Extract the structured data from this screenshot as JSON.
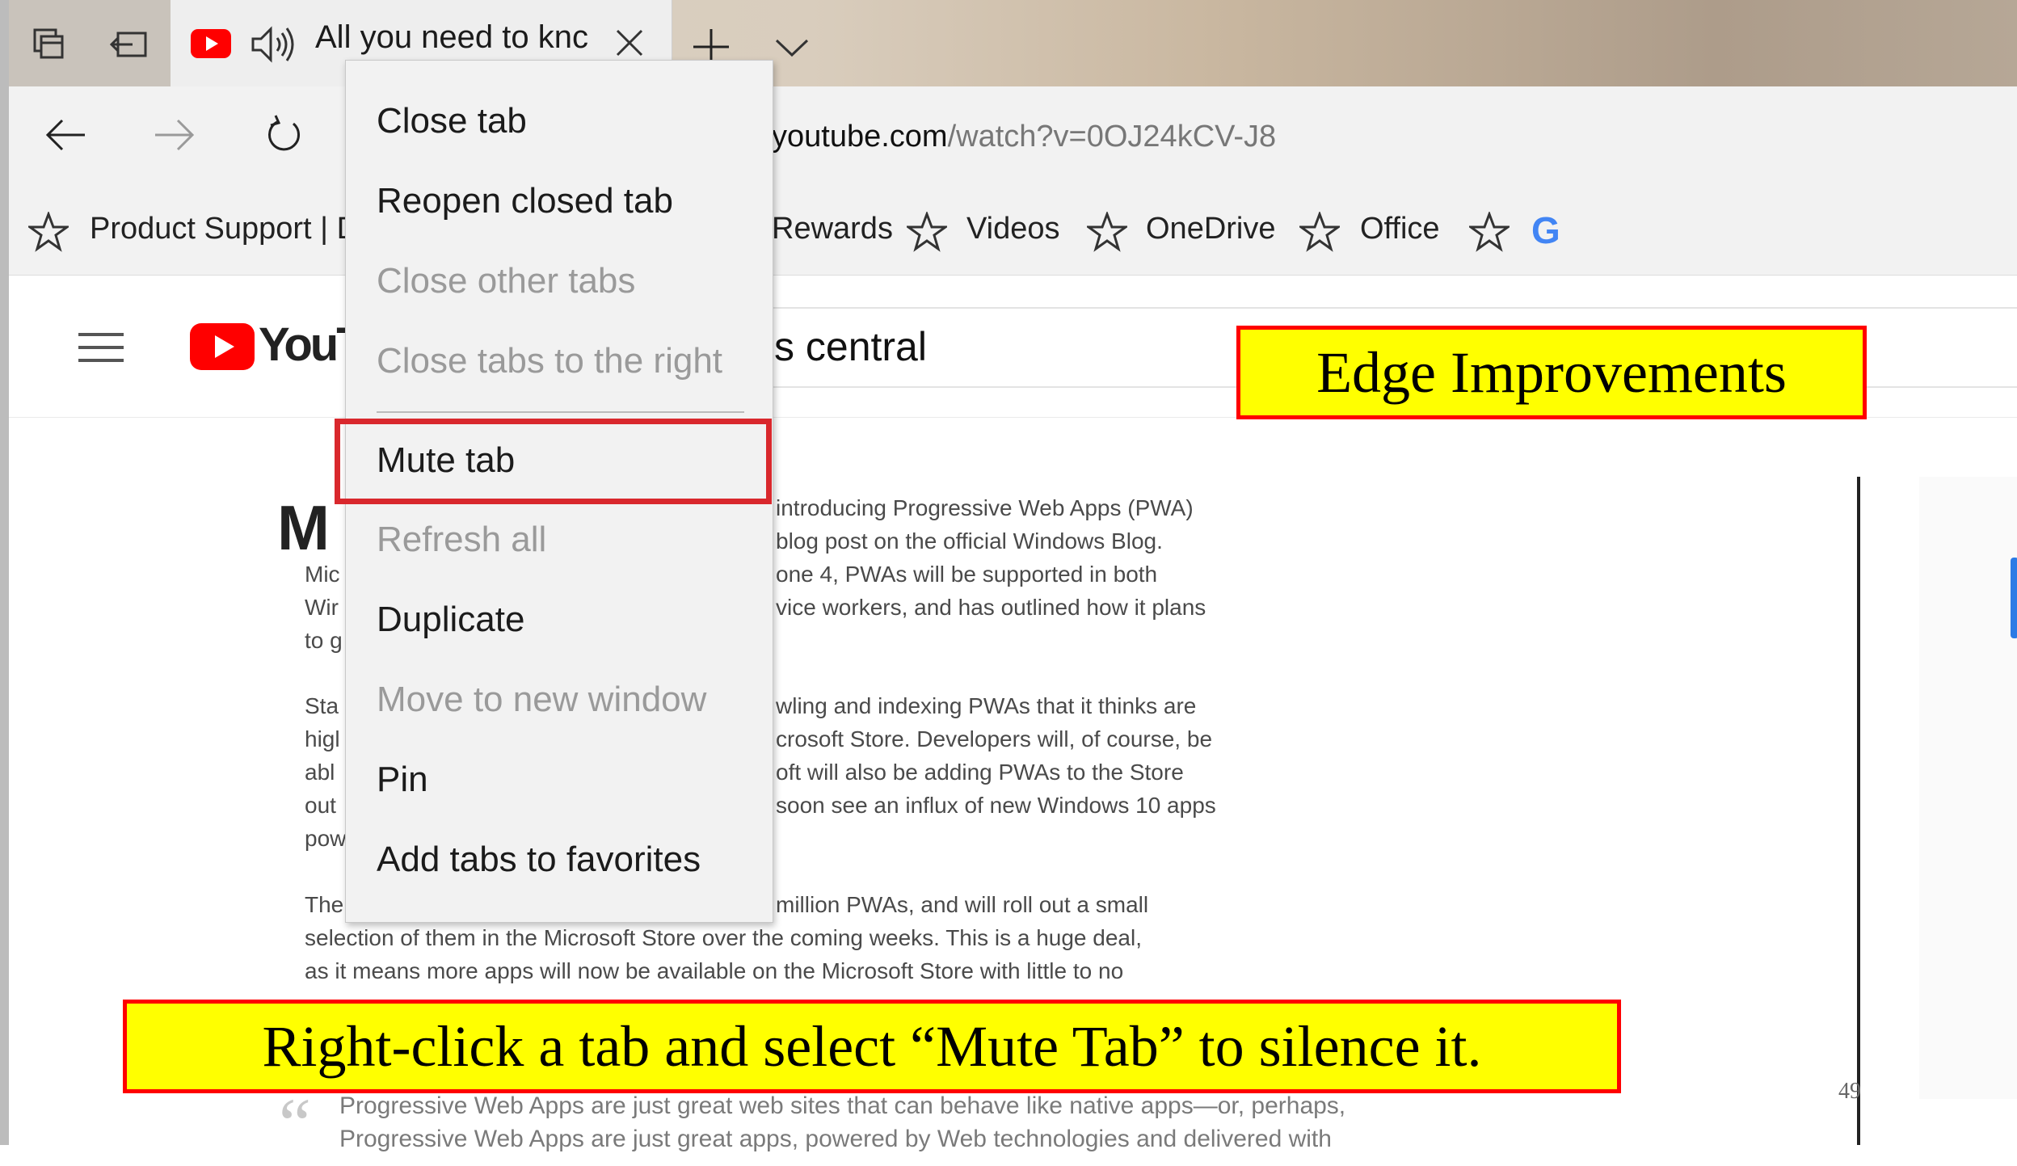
{
  "browser": {
    "tab": {
      "title": "All you need to knc",
      "icons": [
        "tab-preview-icon",
        "set-aside-icon",
        "youtube-favicon",
        "speaker-icon",
        "close-icon"
      ]
    },
    "new_tab_label": "+",
    "address": {
      "host": "youtube.com",
      "path": "/watch?v=0OJ24kCV-J8"
    },
    "favorites": [
      {
        "label": "Product Support | D"
      },
      {
        "label": "Rewards"
      },
      {
        "label": "Videos"
      },
      {
        "label": "OneDrive"
      },
      {
        "label": "Office"
      }
    ],
    "favorites_google_label": "G"
  },
  "context_menu": {
    "items": [
      {
        "label": "Close tab",
        "enabled": true
      },
      {
        "label": "Reopen closed tab",
        "enabled": true
      },
      {
        "label": "Close other tabs",
        "enabled": false
      },
      {
        "label": "Close tabs to the right",
        "enabled": false
      },
      {
        "label": "Mute tab",
        "enabled": true,
        "highlighted": true
      },
      {
        "label": "Refresh all",
        "enabled": false
      },
      {
        "label": "Duplicate",
        "enabled": true
      },
      {
        "label": "Move to new window",
        "enabled": false
      },
      {
        "label": "Pin",
        "enabled": true
      },
      {
        "label": "Add tabs to favorites",
        "enabled": true
      }
    ]
  },
  "page": {
    "youtube_logo": "YouTu",
    "search_text": "s central",
    "dropcap": "M",
    "article_right_lines": [
      "introducing Progressive Web Apps (PWA)",
      "blog post on the official Windows Blog.",
      "one 4, PWAs will be supported in both",
      "vice workers, and has outlined how it plans"
    ],
    "article_left_fragments": [
      "Mic",
      "Wir",
      "to g",
      "Sta",
      "higl",
      "abl",
      "out",
      "pow",
      "The"
    ],
    "article_right_lines2": [
      "wling and indexing PWAs that it thinks are",
      "crosoft Store. Developers will, of course, be",
      "oft will also be adding PWAs to the Store",
      "soon see an influx of new Windows 10 apps"
    ],
    "article_para3_end": "million PWAs, and will roll out a small",
    "article_full_lines": [
      "selection of them in the Microsoft Store over the coming weeks. This is a huge deal,",
      "as it means more apps will now be available on the Microsoft Store with little to no"
    ],
    "quote_lines": [
      "Progressive Web Apps are just great web sites that can behave like native apps—or, perhaps,",
      "Progressive Web Apps are just great apps, powered by Web technologies and delivered with"
    ],
    "page_number": "49"
  },
  "callouts": {
    "title": "Edge Improvements",
    "tip": "Right-click a tab and select “Mute Tab” to silence it."
  },
  "colors": {
    "highlight_border": "#d9282d",
    "callout_fill": "#ffff00",
    "callout_border": "#ff0000",
    "youtube_red": "#ff0000"
  }
}
